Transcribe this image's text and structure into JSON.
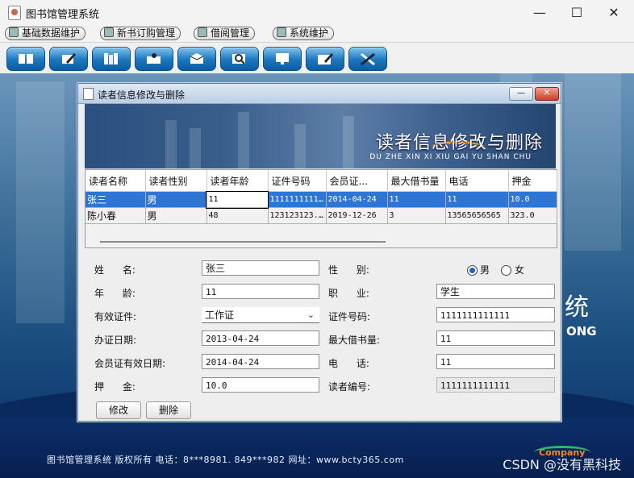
{
  "window": {
    "title": "图书馆管理系统",
    "minimize_icon": "minimize-icon",
    "maximize_icon": "maximize-icon",
    "close_icon": "close-icon"
  },
  "menubar": [
    {
      "label": "基础数据维护"
    },
    {
      "label": "新书订购管理"
    },
    {
      "label": "借阅管理"
    },
    {
      "label": "系统维护"
    }
  ],
  "toolbar_icons": [
    "book-icon",
    "pen-icon",
    "books-icon",
    "checkout-icon",
    "package-icon",
    "magnify-icon",
    "monitor-icon",
    "edit-card-icon",
    "tools-icon"
  ],
  "desktop": {
    "footer": "图书馆管理系统    版权所有    电话：8***8981. 849***982    网址：www.bcty365.com",
    "big_char": "统",
    "big_en": "ONG",
    "watermark": "CSDN @没有黑科技",
    "logo_text": "Company"
  },
  "frame": {
    "title": "读者信息修改与删除",
    "banner_title": "读者信息修改与删除",
    "banner_sub": "DU ZHE  XIN XI XIU GAI YU SHAN CHU"
  },
  "table": {
    "headers": [
      "读者名称",
      "读者性别",
      "读者年龄",
      "证件号码",
      "会员证...",
      "最大借书量",
      "电话",
      "押金"
    ],
    "rows": [
      [
        "张三",
        "男",
        "11",
        "1111111111...",
        "2014-04-24",
        "11",
        "11",
        "10.0"
      ],
      [
        "陈小春",
        "男",
        "48",
        "123123123...",
        "2019-12-26",
        "3",
        "13565656565",
        "323.0"
      ]
    ]
  },
  "form": {
    "name_label": "姓      名:",
    "name": "张三",
    "sex_label": "性      别:",
    "sex_male": "男",
    "sex_female": "女",
    "age_label": "年      龄:",
    "age": "11",
    "job_label": "职      业:",
    "job": "学生",
    "idtype_label": "有效证件:",
    "idtype": "工作证",
    "idno_label": "证件号码:",
    "idno": "1111111111111",
    "date_label": "办证日期:",
    "date": "2013-04-24",
    "maxnum_label": "最大借书量:",
    "maxnum": "11",
    "keep_label": "会员证有效日期:",
    "keep": "2014-04-24",
    "tel_label": "电      话:",
    "tel": "11",
    "deposit_label": "押      金:",
    "deposit": "10.0",
    "readerno_label": "读者编号:",
    "readerno": "1111111111111",
    "modify_button": "修改",
    "delete_button": "删除"
  }
}
